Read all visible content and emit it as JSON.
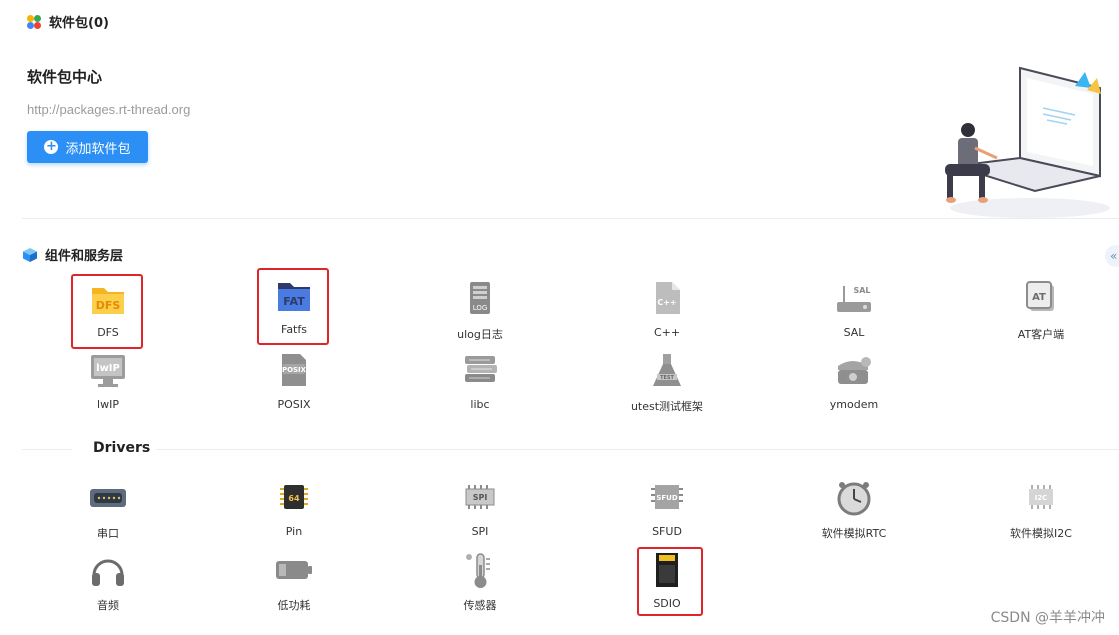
{
  "header": {
    "title": "软件包(0)",
    "icon": "packages-icon"
  },
  "hero": {
    "title": "软件包中心",
    "url": "http://packages.rt-thread.org",
    "add_button_label": "添加软件包",
    "illustration": "woman-with-laptop-illustration"
  },
  "components": {
    "title": "组件和服务层",
    "collapse_glyph": "«",
    "items": [
      {
        "label": "DFS",
        "icon": "dfs-folder-icon",
        "highlighted": true
      },
      {
        "label": "Fatfs",
        "icon": "fatfs-folder-icon",
        "highlighted": true
      },
      {
        "label": "ulog日志",
        "icon": "ulog-icon"
      },
      {
        "label": "C++",
        "icon": "cpp-file-icon"
      },
      {
        "label": "SAL",
        "icon": "sal-router-icon"
      },
      {
        "label": "AT客户端",
        "icon": "at-client-icon"
      },
      {
        "label": "lwIP",
        "icon": "lwip-monitor-icon"
      },
      {
        "label": "POSIX",
        "icon": "posix-icon"
      },
      {
        "label": "libc",
        "icon": "libc-books-icon"
      },
      {
        "label": "utest测试框架",
        "icon": "utest-flask-icon"
      },
      {
        "label": "ymodem",
        "icon": "ymodem-phone-icon"
      }
    ]
  },
  "drivers": {
    "title": "Drivers",
    "items": [
      {
        "label": "串口",
        "icon": "serial-port-icon"
      },
      {
        "label": "Pin",
        "icon": "pin-chip-icon"
      },
      {
        "label": "SPI",
        "icon": "spi-chip-icon"
      },
      {
        "label": "SFUD",
        "icon": "sfud-chip-icon"
      },
      {
        "label": "软件模拟RTC",
        "icon": "clock-icon"
      },
      {
        "label": "软件模拟I2C",
        "icon": "i2c-chip-icon"
      },
      {
        "label": "音频",
        "icon": "headphones-icon"
      },
      {
        "label": "低功耗",
        "icon": "battery-icon"
      },
      {
        "label": "传感器",
        "icon": "thermometer-icon"
      },
      {
        "label": "SDIO",
        "icon": "sd-card-icon",
        "highlighted": true
      }
    ]
  },
  "watermark": "CSDN @羊羊冲冲",
  "colors": {
    "accent": "#2b8ff5",
    "highlight": "#e0242a"
  }
}
